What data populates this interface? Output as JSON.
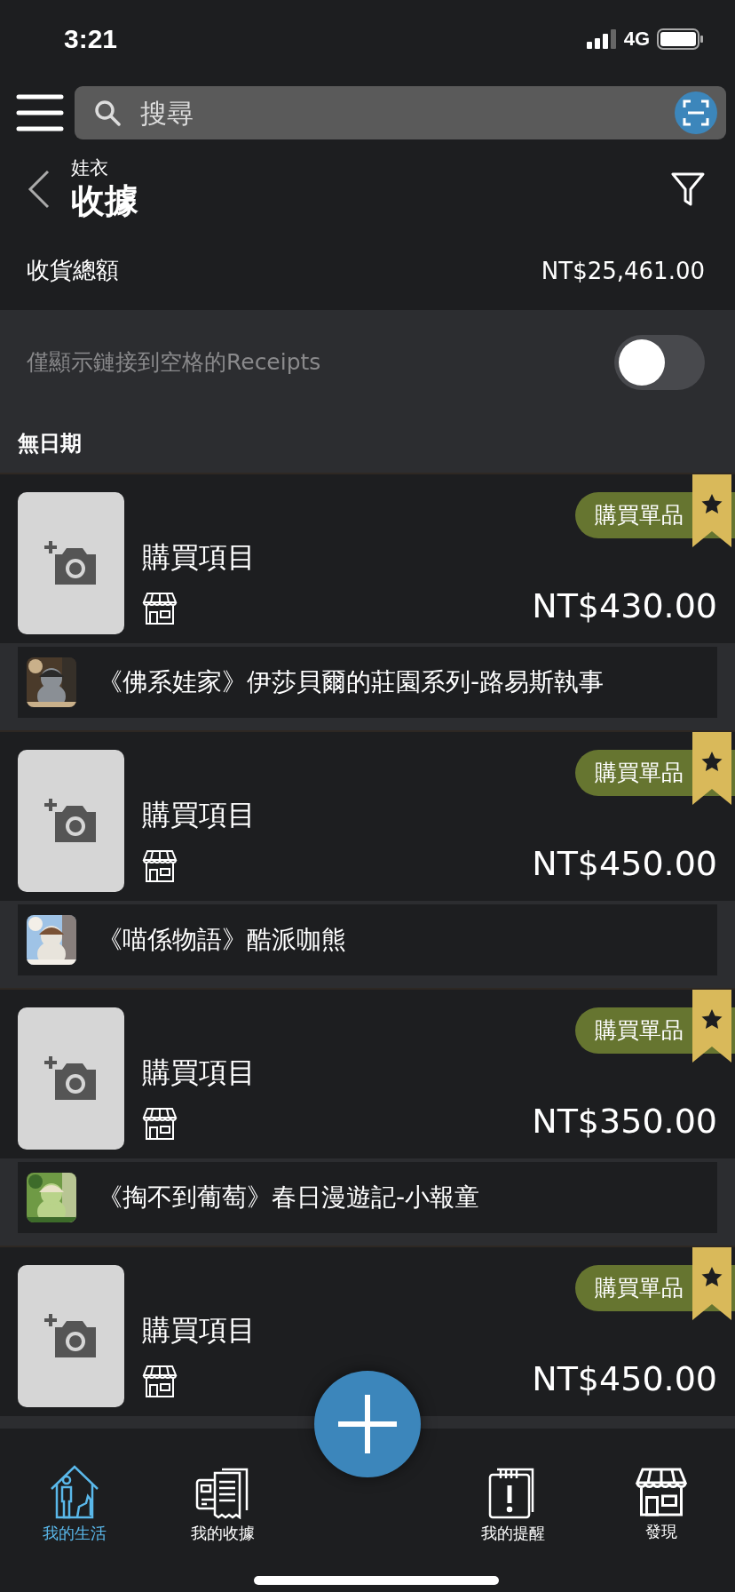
{
  "status_bar": {
    "time": "3:21",
    "network": "4G"
  },
  "search": {
    "placeholder": "搜尋"
  },
  "header": {
    "subtitle": "娃衣",
    "title": "收據"
  },
  "total": {
    "label": "收貨總額",
    "value": "NT$25,461.00"
  },
  "filter_toggle": {
    "label": "僅顯示鏈接到空格的Receipts",
    "on": false
  },
  "section": {
    "title": "無日期"
  },
  "receipts": [
    {
      "title": "購買項目",
      "badge": "購買單品",
      "starred": true,
      "price": "NT$430.00",
      "item": "《佛系娃家》伊莎貝爾的莊園系列-路易斯執事"
    },
    {
      "title": "購買項目",
      "badge": "購買單品",
      "starred": true,
      "price": "NT$450.00",
      "item": "《喵係物語》酷派咖熊"
    },
    {
      "title": "購買項目",
      "badge": "購買單品",
      "starred": true,
      "price": "NT$350.00",
      "item": "《掏不到葡萄》春日漫遊記-小報童"
    },
    {
      "title": "購買項目",
      "badge": "購買單品",
      "starred": true,
      "price": "NT$450.00"
    }
  ],
  "tab_bar": [
    {
      "label": "我的生活",
      "kind": "home",
      "selected": true
    },
    {
      "label": "我的收據",
      "kind": "receipts",
      "selected": false
    },
    {
      "label": "我的提醒",
      "kind": "reminders",
      "selected": false
    },
    {
      "label": "發現",
      "kind": "discover",
      "selected": false
    }
  ]
}
